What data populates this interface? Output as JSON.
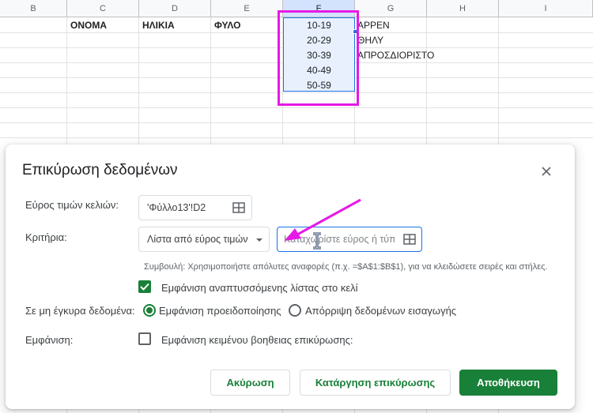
{
  "sheet": {
    "columns": [
      "B",
      "C",
      "D",
      "E",
      "F",
      "G",
      "H",
      "I"
    ],
    "selected_column": "F",
    "header_row": [
      "ΟΝΟΜΑ",
      "ΗΛΙΚΙΑ",
      "ΦΥΛΟ"
    ],
    "age_ranges": [
      "10-19",
      "20-29",
      "30-39",
      "40-49",
      "50-59"
    ],
    "gender_values": [
      "ΑΡΡΕΝ",
      "ΘΗΛΥ",
      "ΑΠΡΟΣΔΙΟΡΙΣΤΟ"
    ]
  },
  "dialog": {
    "title": "Επικύρωση δεδομένων",
    "close_icon": "close-icon",
    "range_label": "Εύρος τιμών κελιών:",
    "range_value": "'Φύλλο13'!D2",
    "criteria_label": "Κριτήρια:",
    "criteria_select": "Λίστα από εύρος τιμών",
    "criteria_placeholder": "Καταχωρίστε εύρος ή τύπο",
    "hint": "Συμβουλή: Χρησιμοποιήστε απόλυτες αναφορές (π.χ. =$A$1:$B$1), για να κλειδώσετε σειρές και στήλες.",
    "show_dropdown_label": "Εμφάνιση αναπτυσσόμενης λίστας στο κελί",
    "show_dropdown_checked": true,
    "invalid_label": "Σε μη έγκυρα δεδομένα:",
    "invalid_options": [
      "Εμφάνιση προειδοποίησης",
      "Απόρριψη δεδομένων εισαγωγής"
    ],
    "invalid_selected": 0,
    "appearance_label": "Εμφάνιση:",
    "appearance_option": "Εμφάνιση κειμένου βοηθειας επικύρωσης:",
    "appearance_checked": false,
    "buttons": {
      "cancel": "Ακύρωση",
      "remove": "Κατάργηση επικύρωσης",
      "save": "Αποθήκευση"
    }
  },
  "colors": {
    "accent": "#188038",
    "selection": "#1a73e8",
    "annotation": "#e619e6"
  }
}
